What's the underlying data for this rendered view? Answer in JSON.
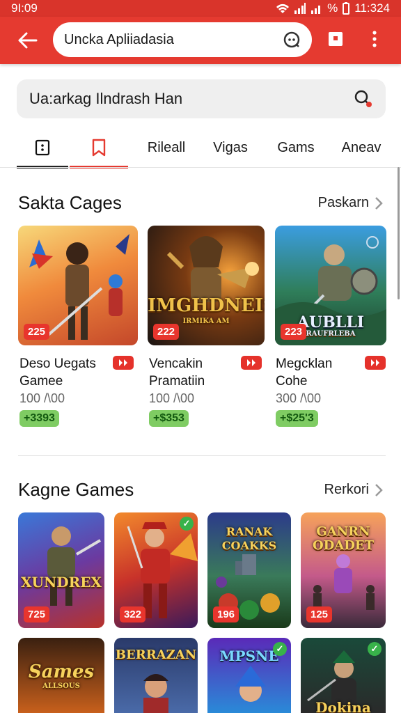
{
  "status_bar": {
    "time": "9I:09",
    "right_text": "11:324",
    "battery_text": "%"
  },
  "app_bar": {
    "url_text": "Uncka Apliiadasia"
  },
  "search": {
    "text": "Ua:arkag Ilndrash Han"
  },
  "tabs": [
    {
      "label": "",
      "icon": "device-icon"
    },
    {
      "label": "",
      "icon": "bookmark-icon"
    },
    {
      "label": "Rileall"
    },
    {
      "label": "Vigas"
    },
    {
      "label": "Gams"
    },
    {
      "label": "Aneav"
    }
  ],
  "section1": {
    "title": "Sakta Cages",
    "link": "Paskarn",
    "cards": [
      {
        "line1": "Deso Uegats",
        "line2": "Gamee",
        "price": "100 /\\00",
        "pill": "+3393",
        "badge": "225",
        "art_title": ""
      },
      {
        "line1": "Vencakin",
        "line2": "Pramatiin",
        "price": "100 /\\00",
        "pill": "+$353",
        "badge": "222",
        "art_title": "IMGHDNEIS",
        "art_sub": "IRMIKA AM"
      },
      {
        "line1": "Megcklan",
        "line2": "Cohe",
        "price": "300 /\\00",
        "pill": "+$25'3",
        "badge": "223",
        "art_title": "AUBLLI",
        "art_sub": "RAUFRLEBA"
      }
    ]
  },
  "section2": {
    "title": "Kagne Games",
    "link": "Rerkori",
    "tiles": [
      {
        "badge": "725",
        "art_title": "XUNDREX",
        "check": false
      },
      {
        "badge": "322",
        "art_title": "",
        "check": true
      },
      {
        "badge": "196",
        "art_title": "RANAK COAKKS",
        "check": false
      },
      {
        "badge": "125",
        "art_title": "GANRN ODADET",
        "check": false
      },
      {
        "art_title": "Sames",
        "art_sub": "ALLSOUS",
        "check": false
      },
      {
        "art_title": "BERRAZAN",
        "check": false
      },
      {
        "art_title": "MPSNE",
        "check": true
      },
      {
        "art_title": "Dokina",
        "check": true
      }
    ]
  },
  "colors": {
    "brand_red": "#e53a30",
    "price_pill": "#7fcc63",
    "badge_red": "#e8352d"
  }
}
